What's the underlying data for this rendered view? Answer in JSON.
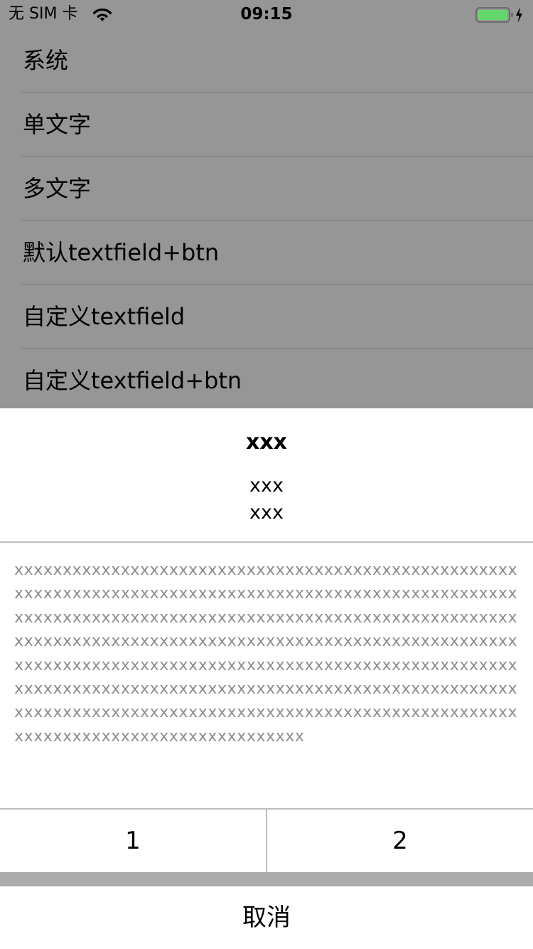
{
  "status_bar": {
    "carrier": "无 SIM 卡",
    "time": "09:15",
    "wifi_icon": "wifi-icon",
    "battery_icon": "battery-charging-icon",
    "battery_color": "#63d86a"
  },
  "list": {
    "items": [
      {
        "label": "系统"
      },
      {
        "label": "单文字"
      },
      {
        "label": "多文字"
      },
      {
        "label": "默认textfield+btn"
      },
      {
        "label": "自定义textfield"
      },
      {
        "label": "自定义textfield+btn"
      }
    ]
  },
  "sheet": {
    "title": "xxx",
    "subtitle_lines": [
      "xxx",
      "xxx"
    ],
    "message": "xxxxxxxxxxxxxxxxxxxxxxxxxxxxxxxxxxxxxxxxxxxxxxxxxxxxxxxxxxxxxxxxxxxxxxxxxxxxxxxxxxxxxxxxxxxxxxxxxxxxxxxxxxxxxxxxxxxxxxxxxxxxxxxxxxxxxxxxxxxxxxxxxxxxxxxxxxxxxxxxxxxxxxxxxxxxxxxxxxxxxxxxxxxxxxxxxxxxxxxxxxxxxxxxxxxxxxxxxxxxxxxxxxxxxxxxxxxxxxxxxxxxxxxxxxxxxxxxxxxxxxxxxxxxxxxxxxxxxxxxxxxxxxxxxxxxxxxxxxxxxxxxxxxxxxxxxxxxxxxxxxxxxxxxxxxxxxxxxxxxxxxxxxxxxxxxxxxxxxxxxxxxxxxxxxxxxxxxxxxxxxxxxxxxxxxxxx",
    "buttons": [
      "1",
      "2"
    ],
    "cancel": "取消"
  }
}
